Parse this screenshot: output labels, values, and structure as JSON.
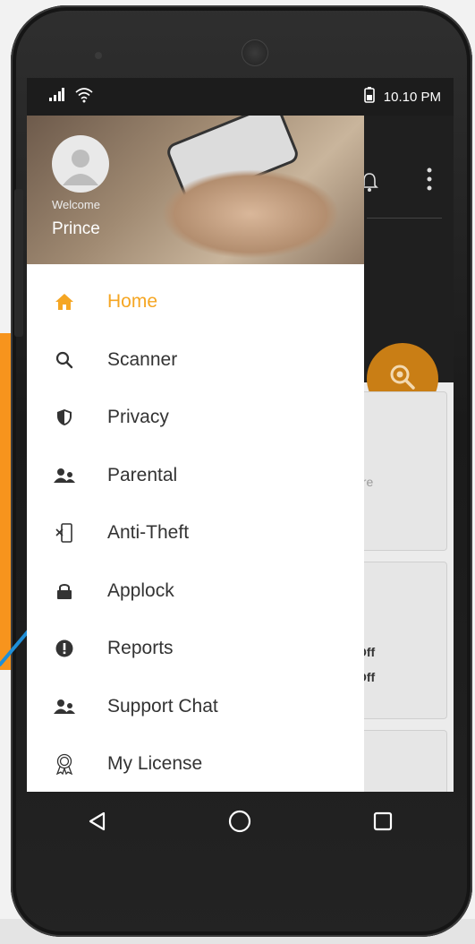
{
  "status_bar": {
    "time": "10.10 PM"
  },
  "drawer": {
    "welcome": "Welcome",
    "user_name": "Prince",
    "items": [
      {
        "label": "Home",
        "icon": "home-icon",
        "active": true
      },
      {
        "label": "Scanner",
        "icon": "search-icon",
        "active": false
      },
      {
        "label": "Privacy",
        "icon": "shield-icon",
        "active": false
      },
      {
        "label": "Parental",
        "icon": "family-icon",
        "active": false
      },
      {
        "label": "Anti-Theft",
        "icon": "phone-exit-icon",
        "active": false
      },
      {
        "label": "Applock",
        "icon": "lock-icon",
        "active": false
      },
      {
        "label": "Reports",
        "icon": "alert-icon",
        "active": false
      },
      {
        "label": "Support Chat",
        "icon": "support-icon",
        "active": false
      },
      {
        "label": "My License",
        "icon": "award-icon",
        "active": false
      }
    ]
  },
  "background_content": {
    "card1_text": "ore",
    "card2_line1": "Off",
    "card2_line2": "Off"
  },
  "colors": {
    "accent": "#f5a623",
    "orange_panel": "#f7941d",
    "arrow": "#1f8fd8",
    "fab": "#c97e15"
  }
}
